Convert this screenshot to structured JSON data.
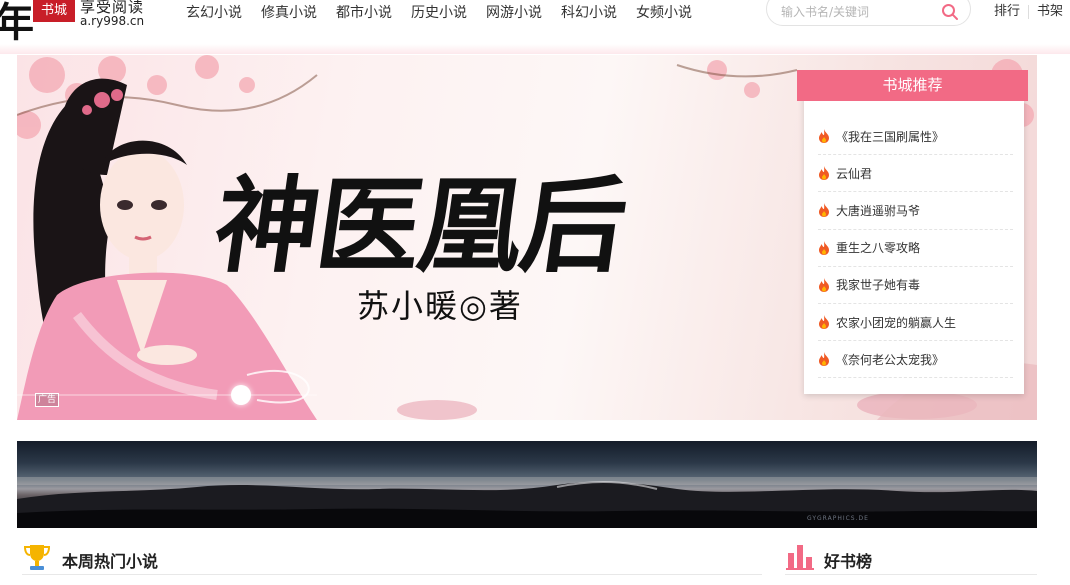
{
  "header": {
    "logo": {
      "char": "年",
      "seal": "书城",
      "slogan": "享受阅读",
      "domain": "a.ry998.cn"
    },
    "nav": [
      "玄幻小说",
      "修真小说",
      "都市小说",
      "历史小说",
      "网游小说",
      "科幻小说",
      "女频小说"
    ],
    "search": {
      "placeholder": "输入书名/关键词"
    },
    "links": {
      "rank": "排行",
      "shelf": "书架"
    }
  },
  "banner": {
    "title": "神医凰后",
    "author": "苏小暖◎著",
    "ad_label": "广告"
  },
  "recommend": {
    "title": "书城推荐",
    "items": [
      "《我在三国刷属性》",
      "云仙君",
      "大唐逍遥驸马爷",
      "重生之八零攻略",
      "我家世子她有毒",
      "农家小团宠的躺赢人生",
      "《奈何老公太宠我》"
    ]
  },
  "landscape": {
    "watermark": "GYGRAPHICS.DE"
  },
  "sections": {
    "hot_title": "本周热门小说",
    "rank_title": "好书榜"
  },
  "colors": {
    "accent": "#f26a85",
    "fire": "#f05a24",
    "trophy": "#f5b400",
    "seal": "#c81e28"
  }
}
